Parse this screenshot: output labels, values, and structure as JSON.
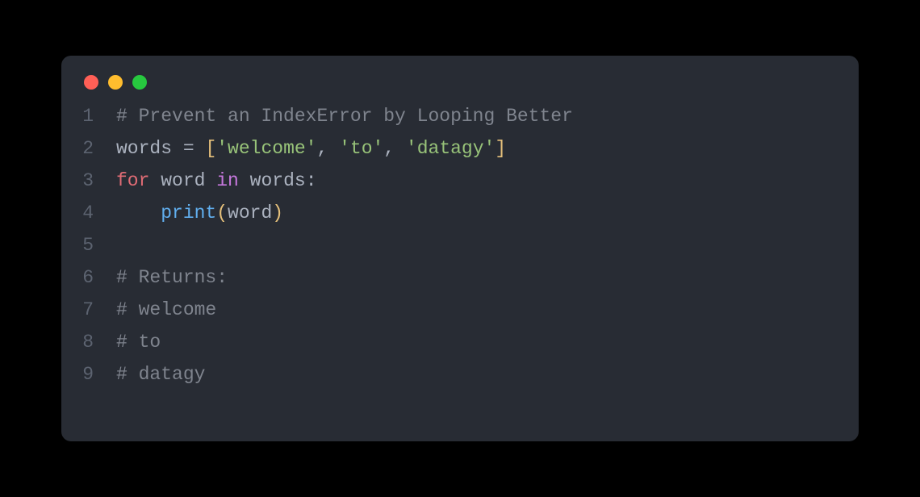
{
  "window": {
    "dots": [
      "red",
      "yellow",
      "green"
    ]
  },
  "code": {
    "lines": [
      {
        "num": "1",
        "tokens": [
          {
            "t": "# Prevent an IndexError by Looping Better",
            "c": "comment"
          }
        ]
      },
      {
        "num": "2",
        "tokens": [
          {
            "t": "words ",
            "c": "plain"
          },
          {
            "t": "=",
            "c": "operator"
          },
          {
            "t": " [",
            "c": "bracket"
          },
          {
            "t": "'welcome'",
            "c": "string"
          },
          {
            "t": ", ",
            "c": "punct"
          },
          {
            "t": "'to'",
            "c": "string"
          },
          {
            "t": ", ",
            "c": "punct"
          },
          {
            "t": "'datagy'",
            "c": "string"
          },
          {
            "t": "]",
            "c": "bracket"
          }
        ]
      },
      {
        "num": "3",
        "tokens": [
          {
            "t": "for",
            "c": "keyword-red"
          },
          {
            "t": " word ",
            "c": "plain"
          },
          {
            "t": "in",
            "c": "kw-in"
          },
          {
            "t": " words",
            "c": "plain"
          },
          {
            "t": ":",
            "c": "punct"
          }
        ]
      },
      {
        "num": "4",
        "tokens": [
          {
            "t": "    ",
            "c": "plain"
          },
          {
            "t": "print",
            "c": "function"
          },
          {
            "t": "(",
            "c": "bracket"
          },
          {
            "t": "word",
            "c": "plain"
          },
          {
            "t": ")",
            "c": "bracket"
          }
        ]
      },
      {
        "num": "5",
        "tokens": []
      },
      {
        "num": "6",
        "tokens": [
          {
            "t": "# Returns:",
            "c": "comment"
          }
        ]
      },
      {
        "num": "7",
        "tokens": [
          {
            "t": "# welcome",
            "c": "comment"
          }
        ]
      },
      {
        "num": "8",
        "tokens": [
          {
            "t": "# to",
            "c": "comment"
          }
        ]
      },
      {
        "num": "9",
        "tokens": [
          {
            "t": "# datagy",
            "c": "comment"
          }
        ]
      }
    ]
  }
}
